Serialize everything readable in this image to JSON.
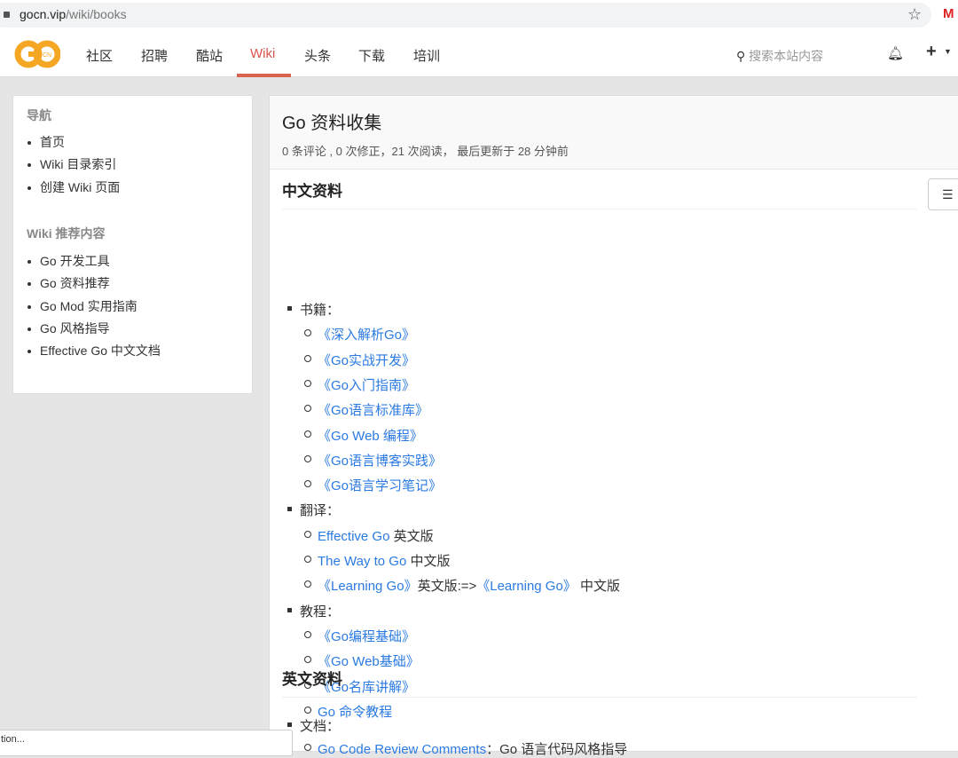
{
  "browser": {
    "url_host": "gocn.vip",
    "url_path": "/wiki/books",
    "gmail": "M"
  },
  "nav": {
    "items": [
      "社区",
      "招聘",
      "酷站",
      "Wiki",
      "头条",
      "下载",
      "培训"
    ],
    "active": "Wiki",
    "search_placeholder": "搜索本站内容",
    "logo_text": "GO",
    "logo_sub": "CN"
  },
  "sidebar": {
    "nav_title": "导航",
    "nav_items": [
      "首页",
      "Wiki 目录索引",
      "创建 Wiki 页面"
    ],
    "rec_title": "Wiki 推荐内容",
    "rec_items": [
      "Go 开发工具",
      "Go 资料推荐",
      "Go Mod 实用指南",
      "Go 风格指导",
      "Effective Go 中文文档"
    ]
  },
  "page": {
    "title": "Go 资料收集",
    "meta": "0 条评论 , 0 次修正，21 次阅读，  最后更新于 28 分钟前",
    "sec1": "中文资料",
    "sec2": "英文资料",
    "books_label": "书籍：",
    "books": [
      "《深入解析Go》",
      "《Go实战开发》",
      "《Go入门指南》",
      "《Go语言标准库》",
      "《Go Web 编程》",
      "《Go语言博客实践》",
      "《Go语言学习笔记》"
    ],
    "trans_label": "翻译：",
    "trans": [
      {
        "link": "Effective Go",
        "text": " 英文版"
      },
      {
        "link": "The Way to Go",
        "text": " 中文版"
      },
      {
        "link": "《Learning Go》",
        "text": "英文版:=>",
        "link2": "《Learning Go》",
        "text2": " 中文版"
      }
    ],
    "tut_label": "教程：",
    "tutorials": [
      "《Go编程基础》",
      "《Go Web基础》",
      "《Go名库讲解》",
      "Go 命令教程"
    ],
    "docs_label": "文档：",
    "docs_link": "Go Code Review Comments",
    "docs_text": "：Go 语言代码风格指导"
  },
  "status_bar": "tion..."
}
